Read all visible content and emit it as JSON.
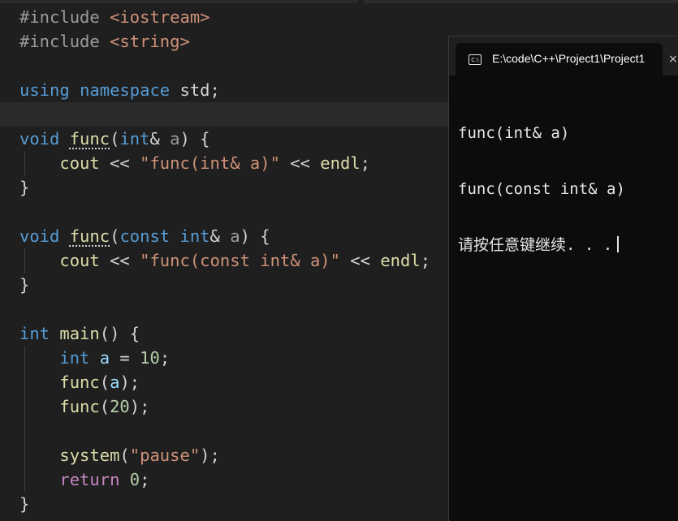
{
  "editor": {
    "lines": [
      {
        "tokens": [
          {
            "t": "#include ",
            "c": "pre"
          },
          {
            "t": "<iostream>",
            "c": "inc"
          }
        ]
      },
      {
        "tokens": [
          {
            "t": "#include ",
            "c": "pre"
          },
          {
            "t": "<string>",
            "c": "inc"
          }
        ]
      },
      {
        "tokens": []
      },
      {
        "tokens": [
          {
            "t": "using ",
            "c": "kw"
          },
          {
            "t": "namespace ",
            "c": "kw"
          },
          {
            "t": "std",
            "c": "pun"
          },
          {
            "t": ";",
            "c": "pun"
          }
        ]
      },
      {
        "tokens": [],
        "current": true
      },
      {
        "tokens": [
          {
            "t": "void ",
            "c": "kw"
          },
          {
            "t": "func",
            "c": "fn dotted"
          },
          {
            "t": "(",
            "c": "pun"
          },
          {
            "t": "int",
            "c": "kw"
          },
          {
            "t": "& ",
            "c": "pun"
          },
          {
            "t": "a",
            "c": "gray"
          },
          {
            "t": ") {",
            "c": "pun"
          }
        ]
      },
      {
        "tokens": [
          {
            "t": "    cout ",
            "c": "fn"
          },
          {
            "t": "<< ",
            "c": "pun"
          },
          {
            "t": "\"func(int& a)\"",
            "c": "str"
          },
          {
            "t": " << ",
            "c": "pun"
          },
          {
            "t": "endl",
            "c": "fn"
          },
          {
            "t": ";",
            "c": "pun"
          }
        ]
      },
      {
        "tokens": [
          {
            "t": "}",
            "c": "pun"
          }
        ]
      },
      {
        "tokens": []
      },
      {
        "tokens": [
          {
            "t": "void ",
            "c": "kw"
          },
          {
            "t": "func",
            "c": "fn dotted"
          },
          {
            "t": "(",
            "c": "pun"
          },
          {
            "t": "const ",
            "c": "kw"
          },
          {
            "t": "int",
            "c": "kw"
          },
          {
            "t": "& ",
            "c": "pun"
          },
          {
            "t": "a",
            "c": "gray"
          },
          {
            "t": ") {",
            "c": "pun"
          }
        ]
      },
      {
        "tokens": [
          {
            "t": "    cout ",
            "c": "fn"
          },
          {
            "t": "<< ",
            "c": "pun"
          },
          {
            "t": "\"func(const int& a)\"",
            "c": "str"
          },
          {
            "t": " << ",
            "c": "pun"
          },
          {
            "t": "endl",
            "c": "fn"
          },
          {
            "t": ";",
            "c": "pun"
          }
        ]
      },
      {
        "tokens": [
          {
            "t": "}",
            "c": "pun"
          }
        ]
      },
      {
        "tokens": []
      },
      {
        "tokens": [
          {
            "t": "int ",
            "c": "kw"
          },
          {
            "t": "main",
            "c": "fn"
          },
          {
            "t": "() {",
            "c": "pun"
          }
        ]
      },
      {
        "tokens": [
          {
            "t": "    int ",
            "c": "kw"
          },
          {
            "t": "a",
            "c": "var"
          },
          {
            "t": " = ",
            "c": "pun"
          },
          {
            "t": "10",
            "c": "num"
          },
          {
            "t": ";",
            "c": "pun"
          }
        ]
      },
      {
        "tokens": [
          {
            "t": "    func",
            "c": "fn"
          },
          {
            "t": "(",
            "c": "pun"
          },
          {
            "t": "a",
            "c": "var"
          },
          {
            "t": ");",
            "c": "pun"
          }
        ]
      },
      {
        "tokens": [
          {
            "t": "    func",
            "c": "fn"
          },
          {
            "t": "(",
            "c": "pun"
          },
          {
            "t": "20",
            "c": "num"
          },
          {
            "t": ");",
            "c": "pun"
          }
        ]
      },
      {
        "tokens": []
      },
      {
        "tokens": [
          {
            "t": "    system",
            "c": "fn"
          },
          {
            "t": "(",
            "c": "pun"
          },
          {
            "t": "\"pause\"",
            "c": "str"
          },
          {
            "t": ");",
            "c": "pun"
          }
        ]
      },
      {
        "tokens": [
          {
            "t": "    return ",
            "c": "ctrl"
          },
          {
            "t": "0",
            "c": "num"
          },
          {
            "t": ";",
            "c": "pun"
          }
        ]
      },
      {
        "tokens": [
          {
            "t": "}",
            "c": "pun"
          }
        ]
      }
    ]
  },
  "console": {
    "title": "E:\\code\\C++\\Project1\\Project1",
    "icon": "cmd-icon",
    "icon_text": "C:\\",
    "close_symbol": "×",
    "output": [
      "func(int& a)",
      "func(const int& a)",
      "请按任意键继续. . ."
    ]
  }
}
